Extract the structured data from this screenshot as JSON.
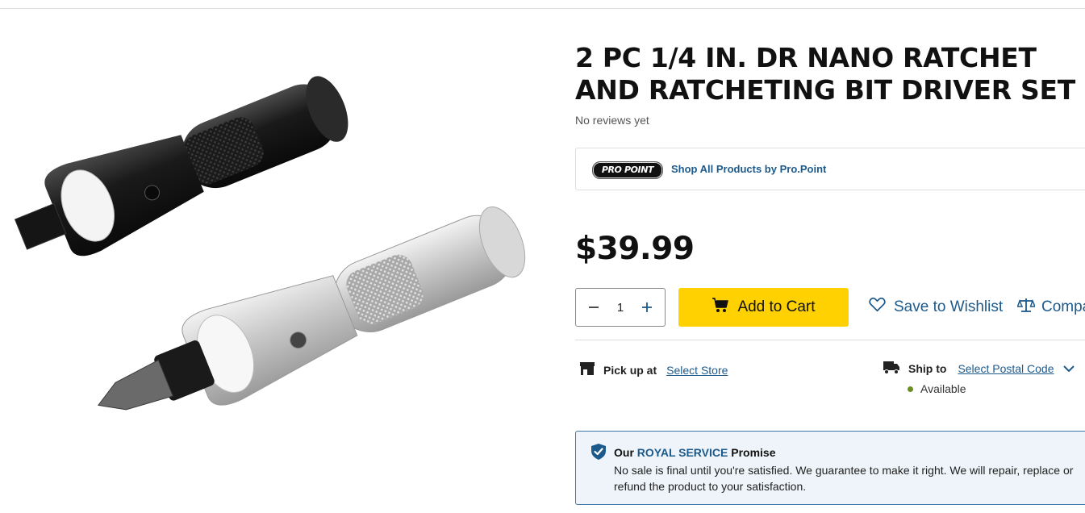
{
  "product": {
    "title": "2 PC 1/4 IN. DR NANO RATCHET AND RATCHETING BIT DRIVER SET",
    "reviews": "No reviews yet",
    "price": "$39.99"
  },
  "brand": {
    "logo_text": "PRO POINT",
    "link": "Shop All Products by Pro.Point"
  },
  "purchase": {
    "quantity": "1",
    "add_to_cart": "Add to Cart",
    "wishlist": "Save to Wishlist",
    "compare": "Compare"
  },
  "fulfillment": {
    "pickup_label": "Pick up at",
    "pickup_link": "Select Store",
    "ship_label": "Ship to",
    "ship_link": "Select Postal Code",
    "availability": "Available"
  },
  "promise": {
    "heading_prefix": "Our",
    "heading_brand": "ROYAL SERVICE",
    "heading_suffix": "Promise",
    "text": "No sale is final until you're satisfied. We guarantee to make it right. We will repair, replace or refund the product to your satisfaction."
  },
  "colors": {
    "accent_yellow": "#ffd100",
    "link_blue": "#1d5a8c",
    "available_green": "#6b8e23"
  },
  "icons": {
    "minus": "minus-icon",
    "plus": "plus-icon",
    "cart": "cart-icon",
    "heart": "heart-icon",
    "compare": "scale-icon",
    "store": "store-icon",
    "truck": "truck-icon",
    "chevron": "chevron-down-icon",
    "shield": "shield-check-icon"
  }
}
